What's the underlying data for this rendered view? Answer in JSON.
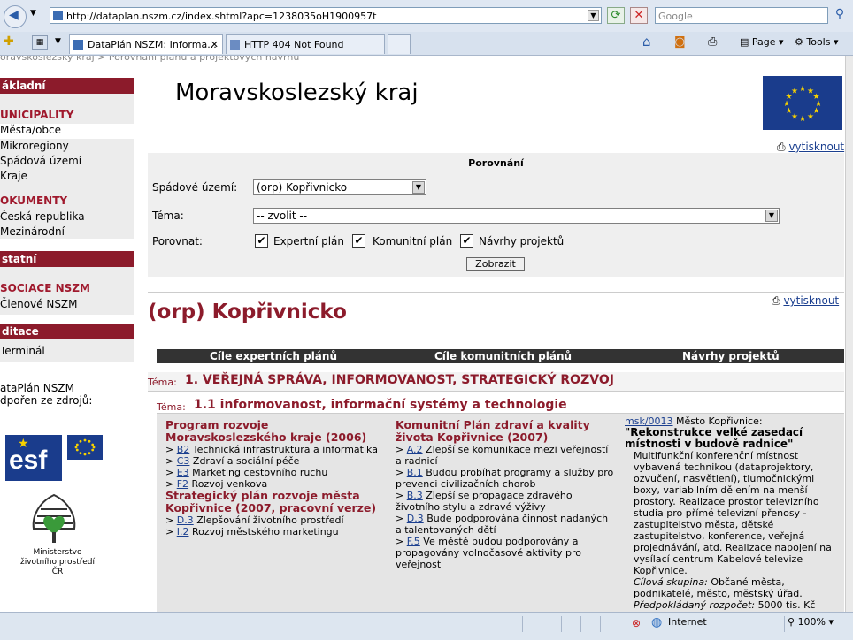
{
  "browser": {
    "url": "http://dataplan.nszm.cz/index.shtml?apc=1238035oH1900957t",
    "search_placeholder": "Google",
    "tabs": [
      {
        "label": "DataPlán NSZM: Informa..."
      },
      {
        "label": "HTTP 404 Not Found"
      }
    ],
    "tools": {
      "page": "Page",
      "tools": "Tools"
    },
    "status": {
      "zone": "Internet",
      "zoom": "100%"
    }
  },
  "breadcrumb": "oravskoslezský kraj   >   Porovnání plánů a projektových návrhů",
  "sidebar": {
    "sections": [
      {
        "title": "ákladní"
      },
      {
        "title": "statní"
      },
      {
        "title": "ditace"
      }
    ],
    "cat_municipality": "UNICIPALITY",
    "items_municipality": [
      "Města/obce",
      "Mikroregiony",
      "Spádová území",
      "Kraje"
    ],
    "cat_documents": "OKUMENTY",
    "items_documents": [
      "Česká republika",
      "Mezinárodní"
    ],
    "cat_association": "SOCIACE NSZM",
    "items_association": [
      "Členové NSZM"
    ],
    "items_edit": [
      "Terminál"
    ],
    "funding_line1": "ataPlán NSZM",
    "funding_line2": "dpořen ze zdrojů:",
    "esf_logo_text": "esf",
    "ministry_label_1": "Ministerstvo",
    "ministry_label_2": "životního prostředí ČR"
  },
  "header": {
    "title": "Moravskoslezský kraj",
    "print_label": "vytisknout"
  },
  "compare_form": {
    "heading": "Porovnání",
    "area_label": "Spádové území:",
    "area_value": "(orp) Kopřivnicko",
    "theme_label": "Téma:",
    "theme_value": "-- zvolit --",
    "compare_label": "Porovnat:",
    "checkboxes": [
      {
        "label": "Expertní plán",
        "checked": true
      },
      {
        "label": "Komunitní plán",
        "checked": true
      },
      {
        "label": "Návrhy projektů",
        "checked": true
      }
    ],
    "submit_label": "Zobrazit"
  },
  "result": {
    "title": "(orp) Kopřivnicko",
    "print_label": "vytisknout",
    "columns": [
      "Cíle expertních plánů",
      "Cíle komunitních plánů",
      "Návrhy projektů"
    ],
    "theme_prefix": "Téma:",
    "theme_1": "1. VEŘEJNÁ SPRÁVA, INFORMOVANOST, STRATEGICKÝ ROZVOJ",
    "theme_2": "1.1 informovanost, informační systémy a technologie",
    "expert": {
      "plan1_title": "Program rozvoje Moravskoslezského kraje (2006)",
      "plan1_items": [
        {
          "code": "B2",
          "text": "Technická infrastruktura a informatika"
        },
        {
          "code": "C3",
          "text": "Zdraví a sociální péče"
        },
        {
          "code": "E3",
          "text": "Marketing cestovního ruchu"
        },
        {
          "code": "F2",
          "text": "Rozvoj venkova"
        }
      ],
      "plan2_title": "Strategický plán rozvoje města Kopřivnice (2007, pracovní verze)",
      "plan2_items": [
        {
          "code": "D.3",
          "text": "Zlepšování životního prostředí"
        },
        {
          "code": "I.2",
          "text": "Rozvoj městského marketingu"
        }
      ]
    },
    "community": {
      "plan_title": "Komunitní Plán zdraví a kvality života Kopřivnice (2007)",
      "items": [
        {
          "code": "A.2",
          "text": "Zlepší se komunikace mezi veřejností a radnicí"
        },
        {
          "code": "B.1",
          "text": "Budou probíhat programy a služby pro prevenci civilizačních chorob"
        },
        {
          "code": "B.3",
          "text": "Zlepší se propagace zdravého životního stylu a zdravé výživy"
        },
        {
          "code": "D.3",
          "text": "Bude podporována činnost nadaných a talentovaných dětí"
        },
        {
          "code": "F.5",
          "text": "Ve městě budou podporovány a propagovány volnočasové aktivity pro veřejnost"
        }
      ]
    },
    "project": {
      "code": "msk/0013",
      "owner": "Město Kopřivnice:",
      "title": "\"Rekonstrukce velké zasedací místnosti v budově radnice\"",
      "description": "Multifunkční konferenční místnost vybavená technikou (dataprojektory, ozvučení, nasvětlení), tlumočnickými boxy, variabilním dělením na menší prostory. Realizace prostor televizního studia pro přímé televizní přenosy - zastupitelstvo města, dětské zastupitelstvo, konference, veřejná projednávání, atd. Realizace napojení na vysílací centrum Kabelové televize Kopřivnice.",
      "target_label": "Cílová skupina:",
      "target_value": "Občané města, podnikatelé, město, městský úřad.",
      "budget_label": "Předpokládaný rozpočet:",
      "budget_value": "5000 tis. Kč"
    }
  }
}
